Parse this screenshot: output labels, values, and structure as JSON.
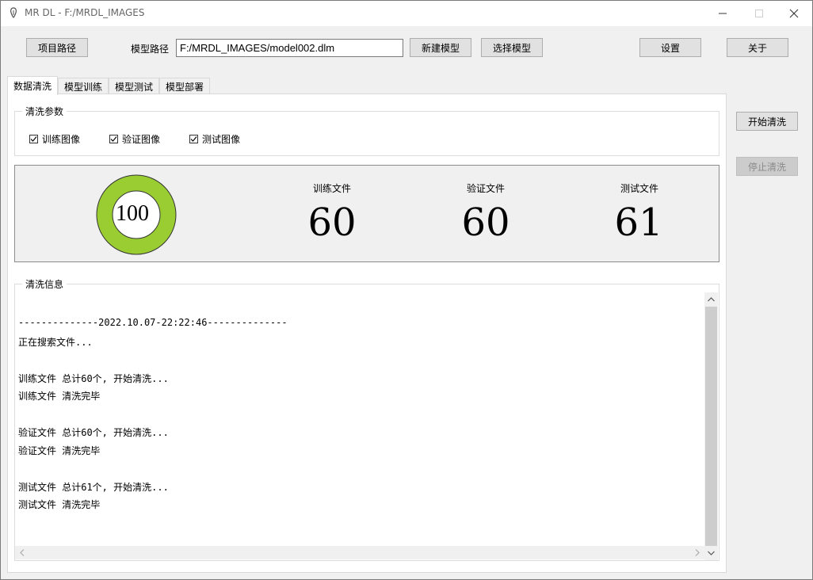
{
  "window": {
    "title": "MR DL - F:/MRDL_IMAGES"
  },
  "toolbar": {
    "project_path_button": "项目路径",
    "model_path_label": "模型路径",
    "model_path_value": "F:/MRDL_IMAGES/model002.dlm",
    "new_model_button": "新建模型",
    "select_model_button": "选择模型",
    "settings_button": "设置",
    "about_button": "关于"
  },
  "tabs": [
    {
      "label": "数据清洗",
      "active": true
    },
    {
      "label": "模型训练",
      "active": false
    },
    {
      "label": "模型测试",
      "active": false
    },
    {
      "label": "模型部署",
      "active": false
    }
  ],
  "clean_params": {
    "legend": "清洗参数",
    "options": [
      {
        "label": "训练图像",
        "checked": true
      },
      {
        "label": "验证图像",
        "checked": true
      },
      {
        "label": "测试图像",
        "checked": true
      }
    ]
  },
  "stats": {
    "progress_value": "100",
    "progress_fraction": 1.0,
    "items": [
      {
        "label": "训练文件",
        "value": "60"
      },
      {
        "label": "验证文件",
        "value": "60"
      },
      {
        "label": "测试文件",
        "value": "61"
      }
    ]
  },
  "side_buttons": {
    "start": "开始清洗",
    "stop": "停止清洗"
  },
  "log": {
    "legend": "清洗信息",
    "lines": [
      "--------------2022.10.07-22:22:46--------------",
      "正在搜索文件...",
      "",
      "训练文件 总计60个, 开始清洗...",
      "训练文件 清洗完毕",
      "",
      "验证文件 总计60个, 开始清洗...",
      "验证文件 清洗完毕",
      "",
      "测试文件 总计61个, 开始清洗...",
      "测试文件 清洗完毕"
    ]
  },
  "colors": {
    "donut_ring": "#9acd32",
    "donut_stroke": "#333333"
  }
}
